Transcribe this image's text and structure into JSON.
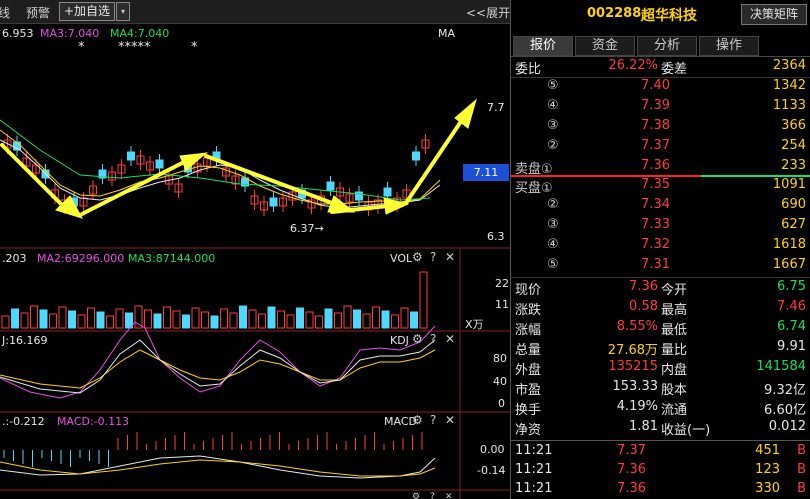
{
  "toolbar": {
    "item1": "线",
    "item2": "预警",
    "add_button": "+加自选",
    "dropdown": "▾",
    "expand": "<<展开"
  },
  "ma": {
    "ma1": "6.953",
    "ma3": "MA3:7.040",
    "ma4": "MA4:7.040",
    "label": "MA",
    "stars": [
      "*",
      "*****",
      "*"
    ]
  },
  "price_axis": {
    "top": "7.7",
    "current": "7.11",
    "bottom": "6.3",
    "low_mark": "6.37→"
  },
  "vol": {
    "ma1": ".203",
    "ma2": "MA2:69296.000",
    "ma3": "MA3:87144.000",
    "label": "VOL",
    "ticks": [
      "22",
      "11"
    ],
    "unit": "X万"
  },
  "kdj": {
    "j": "J:16.169",
    "label": "KDJ",
    "ticks": [
      "80",
      "40",
      "0"
    ]
  },
  "macd": {
    "dif": ".:-0.212",
    "macd": "MACD:-0.113",
    "label": "MACD",
    "ticks": [
      "0.00",
      "-0.14"
    ]
  },
  "stock": {
    "code": "002288",
    "name": "超华科技",
    "decision_button": "决策矩阵"
  },
  "tabs": [
    {
      "label": "报价",
      "active": true
    },
    {
      "label": "资金",
      "active": false
    },
    {
      "label": "分析",
      "active": false
    },
    {
      "label": "操作",
      "active": false
    }
  ],
  "ratio": {
    "label1": "委比",
    "value1": "26.22%",
    "label2": "委差",
    "value2": "2364"
  },
  "sell": [
    {
      "label": "⑤",
      "price": "7.40",
      "vol": "1342"
    },
    {
      "label": "④",
      "price": "7.39",
      "vol": "1133"
    },
    {
      "label": "③",
      "price": "7.38",
      "vol": "366"
    },
    {
      "label": "②",
      "price": "7.37",
      "vol": "254"
    },
    {
      "label": "卖盘①",
      "price": "7.36",
      "vol": "233"
    }
  ],
  "buy": [
    {
      "label": "买盘①",
      "price": "7.35",
      "vol": "1091"
    },
    {
      "label": "②",
      "price": "7.34",
      "vol": "690"
    },
    {
      "label": "③",
      "price": "7.33",
      "vol": "627"
    },
    {
      "label": "④",
      "price": "7.32",
      "vol": "1618"
    },
    {
      "label": "⑤",
      "price": "7.31",
      "vol": "1667"
    }
  ],
  "stats": [
    {
      "l1": "现价",
      "v1": "7.36",
      "c1": "r",
      "l2": "今开",
      "v2": "6.75",
      "c2": "g"
    },
    {
      "l1": "涨跌",
      "v1": "0.58",
      "c1": "r",
      "l2": "最高",
      "v2": "7.46",
      "c2": "r"
    },
    {
      "l1": "涨幅",
      "v1": "8.55%",
      "c1": "r",
      "l2": "最低",
      "v2": "6.74",
      "c2": "g"
    },
    {
      "l1": "总量",
      "v1": "27.68万",
      "c1": "y",
      "l2": "量比",
      "v2": "9.91",
      "c2": "w"
    },
    {
      "l1": "外盘",
      "v1": "135215",
      "c1": "r",
      "l2": "内盘",
      "v2": "141584",
      "c2": "g"
    },
    {
      "l1": "市盈",
      "v1": "153.33",
      "c1": "w",
      "l2": "股本",
      "v2": "9.32亿",
      "c2": "w"
    },
    {
      "l1": "换手",
      "v1": "4.19%",
      "c1": "w",
      "l2": "流通",
      "v2": "6.60亿",
      "c2": "w"
    },
    {
      "l1": "净资",
      "v1": "1.81",
      "c1": "w",
      "l2": "收益(一)",
      "v2": "0.012",
      "c2": "w"
    }
  ],
  "ticks": [
    {
      "time": "11:21",
      "price": "7.37",
      "vol": "451",
      "side": "B"
    },
    {
      "time": "11:21",
      "price": "7.36",
      "vol": "123",
      "side": "B"
    },
    {
      "time": "11:21",
      "price": "7.36",
      "vol": "330",
      "side": "B"
    }
  ]
}
